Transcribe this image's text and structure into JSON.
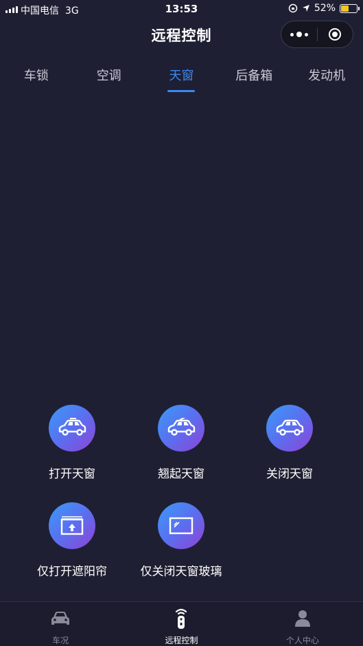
{
  "status_bar": {
    "carrier": "中国电信",
    "network": "3G",
    "time": "13:53",
    "battery": "52%",
    "battery_level": 0.52
  },
  "nav": {
    "title": "远程控制"
  },
  "tabs": [
    {
      "label": "车锁",
      "active": false
    },
    {
      "label": "空调",
      "active": false
    },
    {
      "label": "天窗",
      "active": true
    },
    {
      "label": "后备箱",
      "active": false
    },
    {
      "label": "发动机",
      "active": false
    }
  ],
  "actions": [
    {
      "label": "打开天窗",
      "icon": "car-sunroof-open-icon"
    },
    {
      "label": "翘起天窗",
      "icon": "car-sunroof-tilt-icon"
    },
    {
      "label": "关闭天窗",
      "icon": "car-sunroof-close-icon"
    },
    {
      "label": "仅打开遮阳帘",
      "icon": "sunshade-open-icon"
    },
    {
      "label": "仅关闭天窗玻璃",
      "icon": "sunroof-glass-close-icon"
    }
  ],
  "bottom_tabs": [
    {
      "label": "车况",
      "icon": "car-icon",
      "active": false
    },
    {
      "label": "远程控制",
      "icon": "remote-key-icon",
      "active": true
    },
    {
      "label": "个人中心",
      "icon": "person-icon",
      "active": false
    }
  ],
  "colors": {
    "background": "#1f1f33",
    "accent": "#3d88f0",
    "icon_gradient_start": "#3a9bf7",
    "icon_gradient_end": "#8f43d6"
  }
}
